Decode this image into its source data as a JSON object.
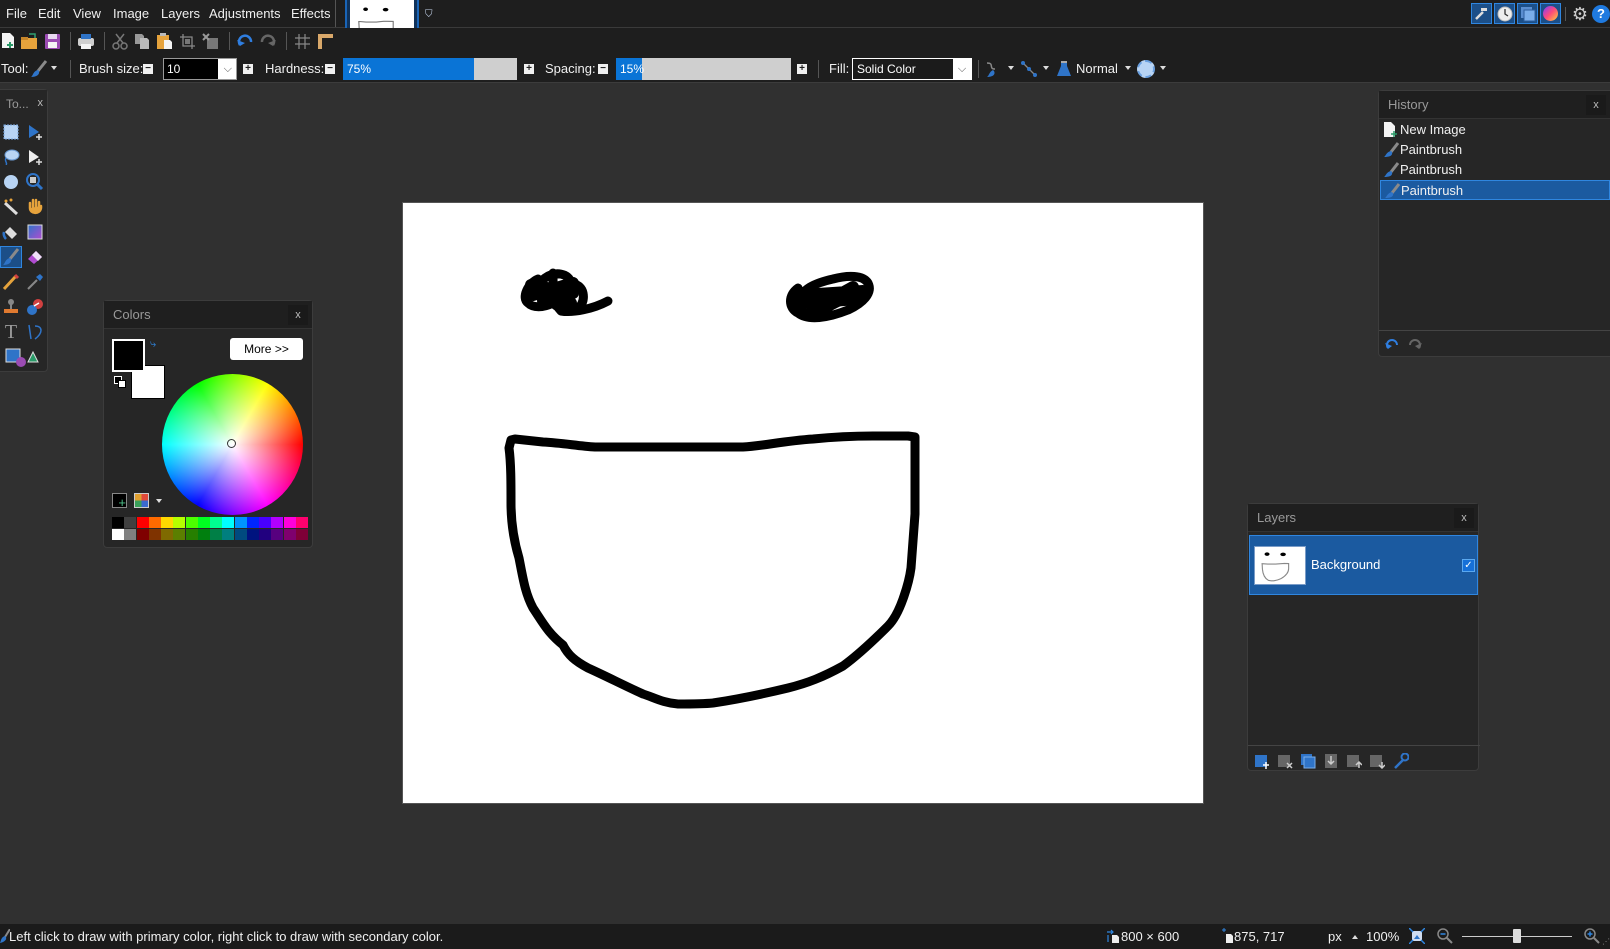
{
  "menu": [
    "File",
    "Edit",
    "View",
    "Image",
    "Layers",
    "Adjustments",
    "Effects"
  ],
  "toolbar": {
    "icons": [
      "new-image-icon",
      "open-icon",
      "save-icon",
      "print-icon",
      "cut-icon",
      "copy-icon",
      "paste-icon",
      "crop-to-selection-icon",
      "deselect-icon",
      "undo-icon",
      "redo-icon",
      "grid-icon",
      "ruler-icon"
    ]
  },
  "window_icons": [
    "tools-window-icon",
    "history-window-icon",
    "layers-window-icon",
    "colors-window-icon",
    "settings-icon",
    "help-icon"
  ],
  "options": {
    "tool_label": "Tool:",
    "brush_size_label": "Brush size:",
    "brush_size_value": "10",
    "hardness_label": "Hardness:",
    "hardness_value": "75%",
    "hardness_fraction": 0.75,
    "spacing_label": "Spacing:",
    "spacing_value": "15%",
    "spacing_fraction": 0.15,
    "fill_label": "Fill:",
    "fill_value": "Solid Color",
    "blend_mode": "Normal"
  },
  "tools_panel": {
    "title": "To...",
    "close": "x",
    "tools": [
      "rectangle-select",
      "move-selected-pixels",
      "lasso-select",
      "move-selection",
      "ellipse-select",
      "zoom",
      "magic-wand",
      "pan",
      "paint-bucket",
      "gradient",
      "paintbrush",
      "eraser",
      "pencil",
      "color-picker",
      "clone-stamp",
      "recolor",
      "text",
      "line-curve",
      "shapes"
    ],
    "active_tool": "paintbrush"
  },
  "colors_panel": {
    "title": "Colors",
    "close": "x",
    "more_button": "More >>",
    "primary_color": "#000000",
    "secondary_color": "#ffffff",
    "palette_top": [
      "#000000",
      "#404040",
      "#ff0000",
      "#ff6a00",
      "#ffd800",
      "#b6ff00",
      "#4cff00",
      "#00ff21",
      "#00ff90",
      "#00ffff",
      "#0094ff",
      "#0026ff",
      "#4800ff",
      "#b200ff",
      "#ff00dc",
      "#ff006e"
    ],
    "palette_bottom": [
      "#ffffff",
      "#808080",
      "#7f0000",
      "#7f3300",
      "#7f6a00",
      "#5b7f00",
      "#267f00",
      "#007f0e",
      "#007f46",
      "#007f7f",
      "#004a7f",
      "#00137f",
      "#21007f",
      "#57007f",
      "#7f006e",
      "#7f0037"
    ]
  },
  "history_panel": {
    "title": "History",
    "close": "x",
    "items": [
      {
        "label": "New Image",
        "icon": "new-image-icon"
      },
      {
        "label": "Paintbrush",
        "icon": "paintbrush-icon"
      },
      {
        "label": "Paintbrush",
        "icon": "paintbrush-icon"
      },
      {
        "label": "Paintbrush",
        "icon": "paintbrush-icon",
        "selected": true
      }
    ]
  },
  "layers_panel": {
    "title": "Layers",
    "close": "x",
    "layers": [
      {
        "name": "Background",
        "visible": true,
        "selected": true
      }
    ],
    "buttons": [
      "add-layer-icon",
      "delete-layer-icon",
      "duplicate-layer-icon",
      "merge-layer-down-icon",
      "move-layer-up-icon",
      "move-layer-down-icon",
      "layer-properties-icon"
    ]
  },
  "status": {
    "hint": "Left click to draw with primary color, right click to draw with secondary color.",
    "image_size": "800 × 600",
    "cursor_pos": "875, 717",
    "units": "px",
    "zoom": "100%",
    "zoom_slider_fraction": 0.5
  }
}
